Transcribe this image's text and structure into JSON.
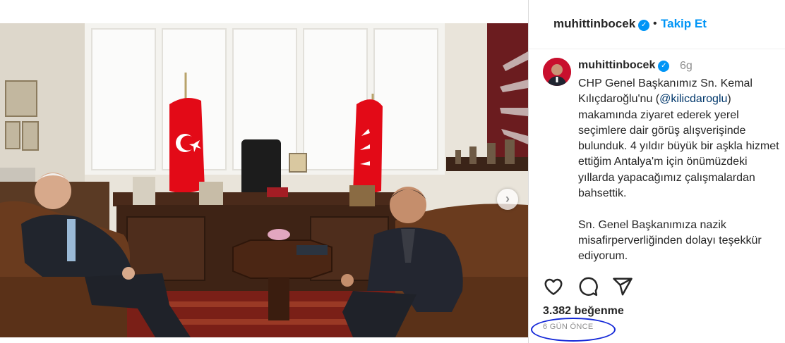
{
  "header": {
    "username": "muhittinbocek",
    "separator": "•",
    "follow_label": "Takip Et"
  },
  "caption": {
    "username": "muhittinbocek",
    "time": "6g",
    "text_before": "CHP Genel Başkanımız Sn. Kemal Kılıçdaroğlu'nu (",
    "mention": "@kilicdaroglu",
    "text_after": ") makamında ziyaret ederek yerel seçimlere dair görüş alışverişinde bulunduk. 4 yıldır büyük bir aşkla hizmet ettiğim Antalya'm için önümüzdeki yıllarda yapacağımız çalışmalardan bahsettik.\n\nSn. Genel Başkanımıza nazik misafirperverliğinden dolayı teşekkür ediyorum."
  },
  "icons": {
    "verified": "verified-badge-icon",
    "like": "heart-icon",
    "comment": "comment-bubble-icon",
    "share": "send-paper-plane-icon",
    "next": "chevron-right-icon"
  },
  "stats": {
    "likes": "3.382 beğenme",
    "posted_ago": "6 GÜN ÖNCE"
  },
  "colors": {
    "accent": "#0095f6",
    "annotation_circle": "#1428d8",
    "flag_red": "#e30a17"
  }
}
